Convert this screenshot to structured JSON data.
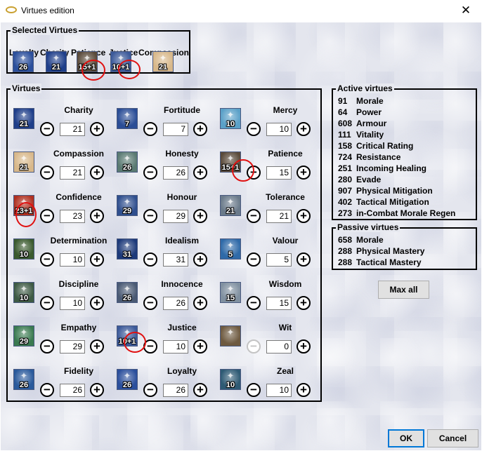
{
  "window": {
    "title": "Virtues edition",
    "close_label": "✕"
  },
  "selected_virtues": {
    "legend": "Selected Virtues",
    "items": [
      {
        "label": "Loyalty",
        "value": "26",
        "icon": "loyalty-icon",
        "color": "#2b4f9c"
      },
      {
        "label": "Charity",
        "value": "21",
        "icon": "charity-icon",
        "color": "#1f3f8a"
      },
      {
        "label": "Patience",
        "value": "15+1",
        "icon": "patience-icon",
        "color": "#5a4a3a"
      },
      {
        "label": "Justice",
        "value": "10+1",
        "icon": "justice-icon",
        "color": "#3c5a9a"
      },
      {
        "label": "Compassion",
        "value": "21",
        "icon": "compassion-icon",
        "color": "#d8b88a"
      }
    ]
  },
  "virtues": {
    "legend": "Virtues",
    "items": [
      {
        "name": "Charity",
        "icon_value": "21",
        "value": "21",
        "icon": "charity-icon",
        "color": "#1f3f8a"
      },
      {
        "name": "Fortitude",
        "icon_value": "7",
        "value": "7",
        "icon": "fortitude-icon",
        "color": "#2a4d96"
      },
      {
        "name": "Mercy",
        "icon_value": "10",
        "value": "10",
        "icon": "mercy-icon",
        "color": "#5aa0c8"
      },
      {
        "name": "Compassion",
        "icon_value": "21",
        "value": "21",
        "icon": "compassion-icon",
        "color": "#d8b88a"
      },
      {
        "name": "Honesty",
        "icon_value": "26",
        "value": "26",
        "icon": "honesty-icon",
        "color": "#5a7a72"
      },
      {
        "name": "Patience",
        "icon_value": "15+1",
        "value": "15",
        "icon": "patience-icon",
        "color": "#5a4a3a"
      },
      {
        "name": "Confidence",
        "icon_value": "23+1",
        "value": "23",
        "icon": "confidence-icon",
        "color": "#b03020"
      },
      {
        "name": "Honour",
        "icon_value": "29",
        "value": "29",
        "icon": "honour-icon",
        "color": "#2f4f8e"
      },
      {
        "name": "Tolerance",
        "icon_value": "21",
        "value": "21",
        "icon": "tolerance-icon",
        "color": "#6a7a8a"
      },
      {
        "name": "Determination",
        "icon_value": "10",
        "value": "10",
        "icon": "determination-icon",
        "color": "#3a5a2e"
      },
      {
        "name": "Idealism",
        "icon_value": "31",
        "value": "31",
        "icon": "idealism-icon",
        "color": "#1d3a7a"
      },
      {
        "name": "Valour",
        "icon_value": "5",
        "value": "5",
        "icon": "valour-icon",
        "color": "#2f6aa8"
      },
      {
        "name": "Discipline",
        "icon_value": "10",
        "value": "10",
        "icon": "discipline-icon",
        "color": "#3e5a44"
      },
      {
        "name": "Innocence",
        "icon_value": "26",
        "value": "26",
        "icon": "innocence-icon",
        "color": "#4a5a74"
      },
      {
        "name": "Wisdom",
        "icon_value": "15",
        "value": "15",
        "icon": "wisdom-icon",
        "color": "#8090a0"
      },
      {
        "name": "Empathy",
        "icon_value": "29",
        "value": "29",
        "icon": "empathy-icon",
        "color": "#3a7a50"
      },
      {
        "name": "Justice",
        "icon_value": "10+1",
        "value": "10",
        "icon": "justice-icon",
        "color": "#3c5a9a"
      },
      {
        "name": "Wit",
        "icon_value": "",
        "value": "0",
        "icon": "wit-icon",
        "color": "#6e5a40",
        "minus_disabled": true
      },
      {
        "name": "Fidelity",
        "icon_value": "26",
        "value": "26",
        "icon": "fidelity-icon",
        "color": "#2a5a9c"
      },
      {
        "name": "Loyalty",
        "icon_value": "26",
        "value": "26",
        "icon": "loyalty-icon",
        "color": "#2b4f9c"
      },
      {
        "name": "Zeal",
        "icon_value": "10",
        "value": "10",
        "icon": "zeal-icon",
        "color": "#2e5a74"
      }
    ]
  },
  "active_virtues": {
    "legend": "Active virtues",
    "stats": [
      {
        "value": "91",
        "name": "Morale"
      },
      {
        "value": "64",
        "name": "Power"
      },
      {
        "value": "608",
        "name": "Armour"
      },
      {
        "value": "111",
        "name": "Vitality"
      },
      {
        "value": "158",
        "name": "Critical Rating"
      },
      {
        "value": "724",
        "name": "Resistance"
      },
      {
        "value": "251",
        "name": "Incoming Healing"
      },
      {
        "value": "280",
        "name": "Evade"
      },
      {
        "value": "907",
        "name": "Physical Mitigation"
      },
      {
        "value": "402",
        "name": "Tactical Mitigation"
      },
      {
        "value": "273",
        "name": "in-Combat Morale Regen"
      }
    ]
  },
  "passive_virtues": {
    "legend": "Passive virtues",
    "stats": [
      {
        "value": "658",
        "name": "Morale"
      },
      {
        "value": "288",
        "name": "Physical Mastery"
      },
      {
        "value": "288",
        "name": "Tactical Mastery"
      }
    ]
  },
  "buttons": {
    "max_all": "Max all",
    "ok": "OK",
    "cancel": "Cancel"
  },
  "controls": {
    "minus": "−",
    "plus": "+"
  }
}
